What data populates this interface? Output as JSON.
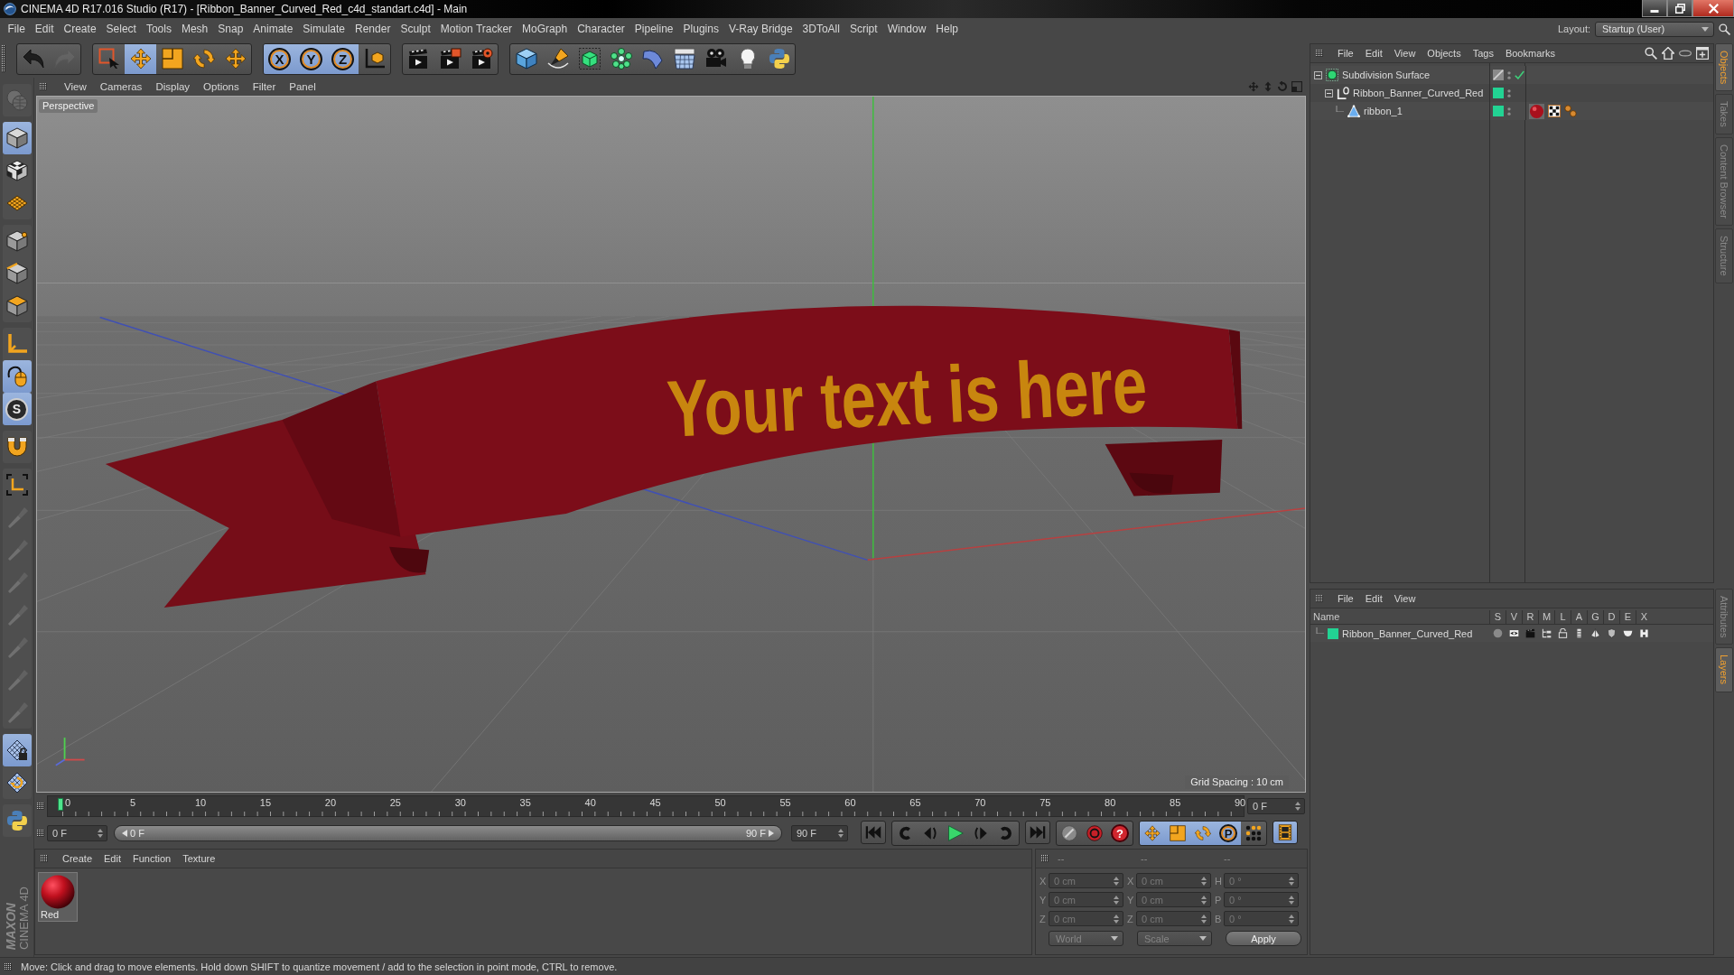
{
  "window": {
    "title": "CINEMA 4D R17.016 Studio (R17) - [Ribbon_Banner_Curved_Red_c4d_standart.c4d] - Main"
  },
  "menu_bar": {
    "items": [
      "File",
      "Edit",
      "Create",
      "Select",
      "Tools",
      "Mesh",
      "Snap",
      "Animate",
      "Simulate",
      "Render",
      "Sculpt",
      "Motion Tracker",
      "MoGraph",
      "Character",
      "Pipeline",
      "Plugins",
      "V-Ray Bridge",
      "3DToAll",
      "Script",
      "Window",
      "Help"
    ],
    "layout_label": "Layout:",
    "layout_value": "Startup (User)"
  },
  "toolbar": {
    "groups": [
      [
        {
          "selected": false,
          "disabled": false
        },
        {
          "selected": false,
          "disabled": true
        }
      ],
      [
        {
          "selected": false
        },
        {
          "selected": true
        },
        {
          "selected": false
        },
        {
          "selected": false
        },
        {
          "selected": false
        }
      ],
      [
        {
          "label": "X",
          "selected": true
        },
        {
          "label": "Y",
          "selected": true
        },
        {
          "label": "Z",
          "selected": true
        },
        {
          "selected": false
        }
      ],
      [
        {
          "selected": false
        },
        {
          "selected": false
        },
        {
          "selected": false
        }
      ],
      [
        {
          "selected": false
        },
        {
          "selected": false
        },
        {
          "selected": false
        },
        {
          "selected": false
        },
        {
          "selected": false
        },
        {
          "selected": false
        },
        {
          "selected": false
        },
        {
          "selected": false
        },
        {
          "selected": false
        }
      ]
    ]
  },
  "left_toolbar": {
    "groups": [
      [
        {
          "selected": false,
          "disabled": true
        }
      ],
      [
        {
          "selected": true
        },
        {
          "selected": false
        },
        {
          "selected": false
        }
      ],
      [
        {
          "selected": false
        },
        {
          "selected": false
        },
        {
          "selected": false
        }
      ],
      [
        {
          "selected": false
        },
        {
          "selected": true
        },
        {
          "label": "S",
          "selected": true
        }
      ],
      [
        {
          "selected": false
        }
      ],
      [
        {
          "selected": false,
          "disabled": false
        },
        {
          "selected": false,
          "disabled": true
        },
        {
          "selected": false,
          "disabled": true
        },
        {
          "selected": false,
          "disabled": true
        },
        {
          "selected": false,
          "disabled": true
        },
        {
          "selected": false,
          "disabled": true
        },
        {
          "selected": false,
          "disabled": true
        },
        {
          "selected": false,
          "disabled": true
        }
      ],
      [
        {
          "selected": true
        },
        {
          "selected": false
        }
      ],
      [
        {
          "selected": false
        }
      ]
    ]
  },
  "viewport": {
    "menu": [
      "View",
      "Cameras",
      "Display",
      "Options",
      "Filter",
      "Panel"
    ],
    "camera": "Perspective",
    "ribbon_text": "Your text is here",
    "grid_spacing": "Grid Spacing : 10 cm"
  },
  "timeline": {
    "frame_labels": [
      "0",
      "5",
      "10",
      "15",
      "20",
      "25",
      "30",
      "35",
      "40",
      "45",
      "50",
      "55",
      "60",
      "65",
      "70",
      "75",
      "80",
      "85",
      "90"
    ],
    "level": 0,
    "current_frame": "0 F"
  },
  "range": {
    "start": "0 F",
    "slider_start": "0 F",
    "slider_end": "90 F",
    "level": 1,
    "end": "90 F"
  },
  "transport": {
    "groups": [
      [
        {
          "selected": false
        }
      ],
      [
        {
          "selected": false
        },
        {
          "selected": false
        },
        {
          "selected": false
        },
        {
          "selected": false
        },
        {
          "selected": false
        }
      ],
      [
        {
          "selected": false
        }
      ],
      [
        {
          "selected": false
        },
        {
          "selected": false
        },
        {
          "label": "?",
          "selected": false
        }
      ],
      [
        {
          "selected": true
        },
        {
          "selected": true
        },
        {
          "selected": true
        },
        {
          "label": "P",
          "selected": true
        },
        {
          "selected": false
        }
      ],
      [
        {
          "selected": true
        }
      ]
    ]
  },
  "material_manager": {
    "menu": [
      "Create",
      "Edit",
      "Function",
      "Texture"
    ],
    "materials": [
      {
        "name": "Red"
      }
    ]
  },
  "coordinates": {
    "disabled": true,
    "headers": [
      "--",
      "--",
      "--"
    ],
    "columns": [
      {
        "rows": [
          {
            "axis": "X",
            "value": "0 cm"
          },
          {
            "axis": "Y",
            "value": "0 cm"
          },
          {
            "axis": "Z",
            "value": "0 cm"
          }
        ]
      },
      {
        "rows": [
          {
            "axis": "X",
            "value": "0 cm"
          },
          {
            "axis": "Y",
            "value": "0 cm"
          },
          {
            "axis": "Z",
            "value": "0 cm"
          }
        ]
      },
      {
        "rows": [
          {
            "axis": "H",
            "value": "0 °"
          },
          {
            "axis": "P",
            "value": "0 °"
          },
          {
            "axis": "B",
            "value": "0 °"
          }
        ]
      }
    ],
    "space": "World",
    "mode": "Scale",
    "apply": "Apply"
  },
  "status_bar": {
    "text": "Move: Click and drag to move elements. Hold down SHIFT to quantize movement / add to the selection in point mode, CTRL to remove."
  },
  "object_manager": {
    "menu": [
      "File",
      "Edit",
      "View",
      "Objects",
      "Tags",
      "Bookmarks"
    ],
    "objects": [
      {
        "name": "Subdivision Surface",
        "kind": "generator",
        "expanded": true,
        "enabled": true,
        "children": [
          {
            "name": "Ribbon_Banner_Curved_Red",
            "kind": "null",
            "color": "#22d393",
            "expanded": true,
            "children": [
              {
                "name": "ribbon_1",
                "kind": "polygon",
                "color": "#22d393",
                "tags": [
                  {
                    "kind": "material"
                  },
                  {
                    "kind": "uvw"
                  },
                  {
                    "kind": "phong"
                  }
                ]
              }
            ]
          }
        ]
      }
    ]
  },
  "layer_manager": {
    "menu": [
      "File",
      "Edit",
      "View"
    ],
    "columns": [
      "Name",
      "S",
      "V",
      "R",
      "M",
      "L",
      "A",
      "G",
      "D",
      "E",
      "X"
    ],
    "layers": [
      {
        "name": "Ribbon_Banner_Curved_Red",
        "color": "#22d393"
      }
    ]
  },
  "side_tabs": {
    "top": [
      {
        "label": "Objects",
        "selected": true
      },
      {
        "label": "Takes",
        "selected": false
      },
      {
        "label": "Content Browser",
        "selected": false
      },
      {
        "label": "Structure",
        "selected": false
      }
    ],
    "bottom": [
      {
        "label": "Attributes",
        "selected": false
      },
      {
        "label": "Layers",
        "selected": true
      }
    ]
  },
  "logo": {
    "brand": "MAXON",
    "product": "CINEMA 4D"
  }
}
